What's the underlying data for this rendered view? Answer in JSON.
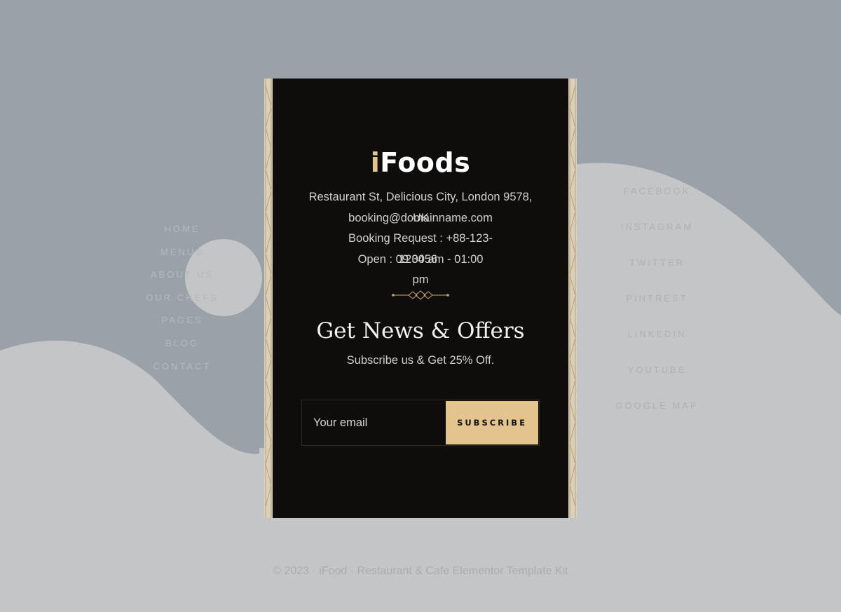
{
  "brand": {
    "logo_accent": "i",
    "logo_rest": "Foods",
    "accent_color": "#e3c48d"
  },
  "contact": {
    "address": "Restaurant St, Delicious City, London 9578,",
    "email_line": "booking@domainname.com",
    "overlap_country": "UK",
    "phone_line1": "Booking Request : +88-123-",
    "phone_line2": "123456",
    "hours_line1": "Open : 09:00 am - 01:00",
    "hours_line2": "pm"
  },
  "newsletter": {
    "title": "Get News & Offers",
    "subtitle": "Subscribe us & Get 25% Off.",
    "email_placeholder": "Your email",
    "button_label": "SUBSCRIBE"
  },
  "menu_left": [
    "Home",
    "Menus",
    "About Us",
    "Our Chefs",
    "Pages",
    "Blog",
    "Contact"
  ],
  "menu_right": [
    "Facebook",
    "Instagram",
    "Twitter",
    "Pintrest",
    "Linkedin",
    "Youtube",
    "Google Map"
  ],
  "footer": {
    "copyright": "© 2023 · iFood · Restaurant & Cafe Elementor Template Kit"
  },
  "colors": {
    "panel": "#0f0d0b",
    "backdrop": "#9aa1a8",
    "wave": "#c4c5c6"
  }
}
